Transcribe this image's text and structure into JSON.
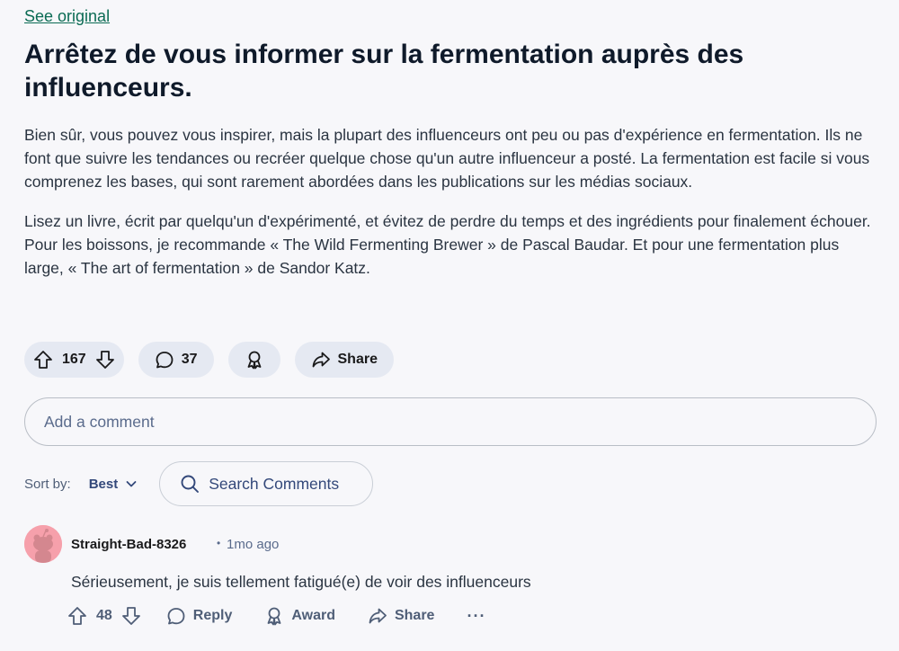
{
  "header": {
    "see_original": "See original"
  },
  "post": {
    "title": "Arrêtez de vous informer sur la fermentation auprès des influenceurs.",
    "paragraphs": [
      "Bien sûr, vous pouvez vous inspirer, mais la plupart des influenceurs ont peu ou pas d'expérience en fermentation. Ils ne font que suivre les tendances ou recréer quelque chose qu'un autre influenceur a posté. La fermentation est facile si vous comprenez les bases, qui sont rarement abordées dans les publications sur les médias sociaux.",
      "Lisez un livre, écrit par quelqu'un d'expérimenté, et évitez de perdre du temps et des ingrédients pour finalement échouer. Pour les boissons, je recommande « The Wild Fermenting Brewer » de Pascal Baudar. Et pour une fermentation plus large, « The art of fermentation » de Sandor Katz."
    ],
    "votes": "167",
    "comments": "37",
    "share_label": "Share"
  },
  "comment_box": {
    "placeholder": "Add a comment"
  },
  "sort": {
    "label": "Sort by:",
    "value": "Best"
  },
  "search": {
    "placeholder": "Search Comments"
  },
  "comments": [
    {
      "author": "Straight-Bad-8326",
      "separator": "•",
      "time": "1mo ago",
      "text": "Sérieusement, je suis tellement fatigué(e) de voir des influenceurs",
      "votes": "48",
      "reply_label": "Reply",
      "award_label": "Award",
      "share_label": "Share",
      "more_label": "···"
    }
  ],
  "colors": {
    "background": "#f7f7fa",
    "pill": "#e5e9f2",
    "link": "#0b6b54",
    "avatar": "#f6a0ab"
  }
}
